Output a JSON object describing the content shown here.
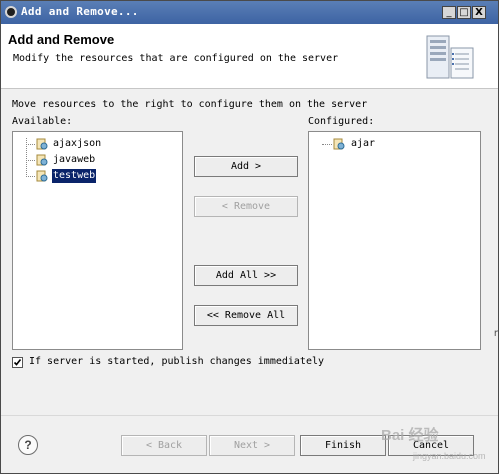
{
  "window": {
    "title": "Add and Remove...",
    "controls": {
      "minimize": "_",
      "maximize": "□",
      "close": "X"
    }
  },
  "header": {
    "title": "Add and Remove",
    "description": "Modify the resources that are configured on the server",
    "icon": "server-config-icon"
  },
  "instruction": "Move resources to the right to configure them on the server",
  "available": {
    "label": "Available:",
    "items": [
      {
        "label": "ajaxjson",
        "selected": false
      },
      {
        "label": "javaweb",
        "selected": false
      },
      {
        "label": "testweb",
        "selected": true
      }
    ]
  },
  "configured": {
    "label": "Configured:",
    "items": [
      {
        "label": "ajar"
      }
    ]
  },
  "actions": {
    "add": "Add >",
    "remove": "< Remove",
    "add_all": "Add All >>",
    "remove_all": "<< Remove All"
  },
  "publish": {
    "checked": true,
    "label": "If server is started, publish changes immediately"
  },
  "footer": {
    "help": "?",
    "back": "< Back",
    "next": "Next >",
    "finish": "Finish",
    "cancel": "Cancel"
  },
  "watermark": {
    "main": "Bai 经验",
    "sub": "jingyan.baidu.com"
  },
  "edge_glyph": "r",
  "colors": {
    "titlebar": "#4a70ad",
    "selection": "#0a246a",
    "disabled_text": "#a0a0a0"
  }
}
